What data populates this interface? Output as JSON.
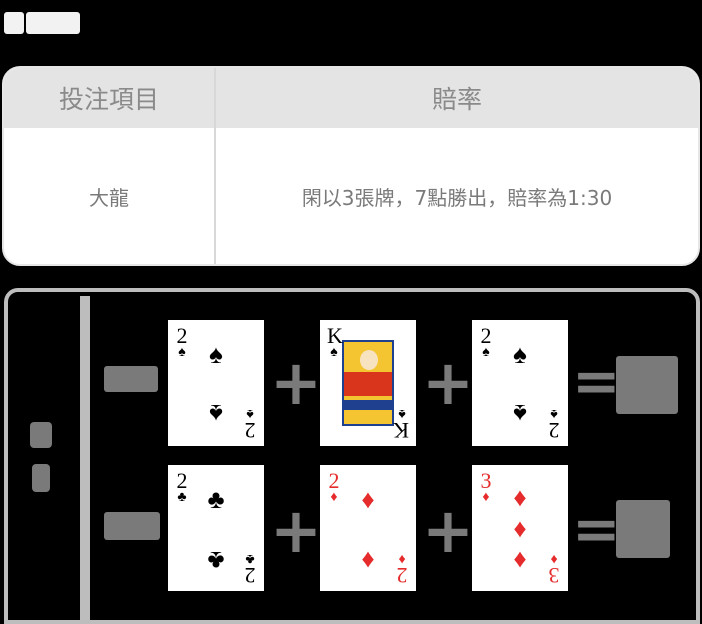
{
  "table": {
    "header": {
      "col1": "投注項目",
      "col2": "賠率"
    },
    "row": {
      "bet": "大龍",
      "payout": "閑以3張牌，7點勝出，賠率為1:30"
    }
  },
  "example": {
    "player_cards": [
      {
        "rank": "2",
        "suit": "♠",
        "color": "black"
      },
      {
        "rank": "K",
        "suit": "♠",
        "color": "black"
      },
      {
        "rank": "2",
        "suit": "♠",
        "color": "black"
      }
    ],
    "banker_cards": [
      {
        "rank": "2",
        "suit": "♣",
        "color": "black"
      },
      {
        "rank": "2",
        "suit": "♦",
        "color": "red"
      },
      {
        "rank": "3",
        "suit": "♦",
        "color": "red"
      }
    ],
    "operators": {
      "plus": "+",
      "equals": "="
    }
  },
  "colors": {
    "red_suit": "#e52b2b",
    "black_suit": "#000000",
    "panel_border": "#bdbdbd"
  }
}
